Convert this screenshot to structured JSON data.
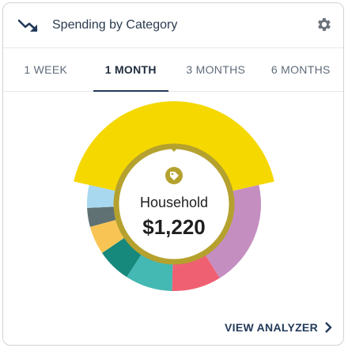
{
  "header": {
    "title": "Spending by Category",
    "icon": "trend-down-icon",
    "settings_icon": "gear-icon"
  },
  "tabs": [
    {
      "label": "1 WEEK",
      "active": false
    },
    {
      "label": "1 MONTH",
      "active": true
    },
    {
      "label": "3 MONTHS",
      "active": false
    },
    {
      "label": "6 MONTHS",
      "active": false
    }
  ],
  "selected": {
    "category": "Household",
    "amount": "$1,220",
    "icon": "tag-icon"
  },
  "chart_data": {
    "type": "pie",
    "variant": "donut",
    "slices": [
      {
        "label": "Household",
        "value": 1220,
        "color": "#f5d800",
        "selected": true
      },
      {
        "label": "",
        "value": 560,
        "color": "#c58ec1"
      },
      {
        "label": "",
        "value": 260,
        "color": "#ef6072"
      },
      {
        "label": "",
        "value": 250,
        "color": "#44b8b2"
      },
      {
        "label": "",
        "value": 180,
        "color": "#16887c"
      },
      {
        "label": "",
        "value": 150,
        "color": "#f8c555"
      },
      {
        "label": "",
        "value": 100,
        "color": "#5f7173"
      },
      {
        "label": "",
        "value": 120,
        "color": "#a8d8ef"
      }
    ]
  },
  "footer": {
    "link_label": "VIEW ANALYZER",
    "icon": "chevron-right-icon"
  },
  "colors": {
    "accent": "#233a5a",
    "ring": "#b5a12e"
  }
}
